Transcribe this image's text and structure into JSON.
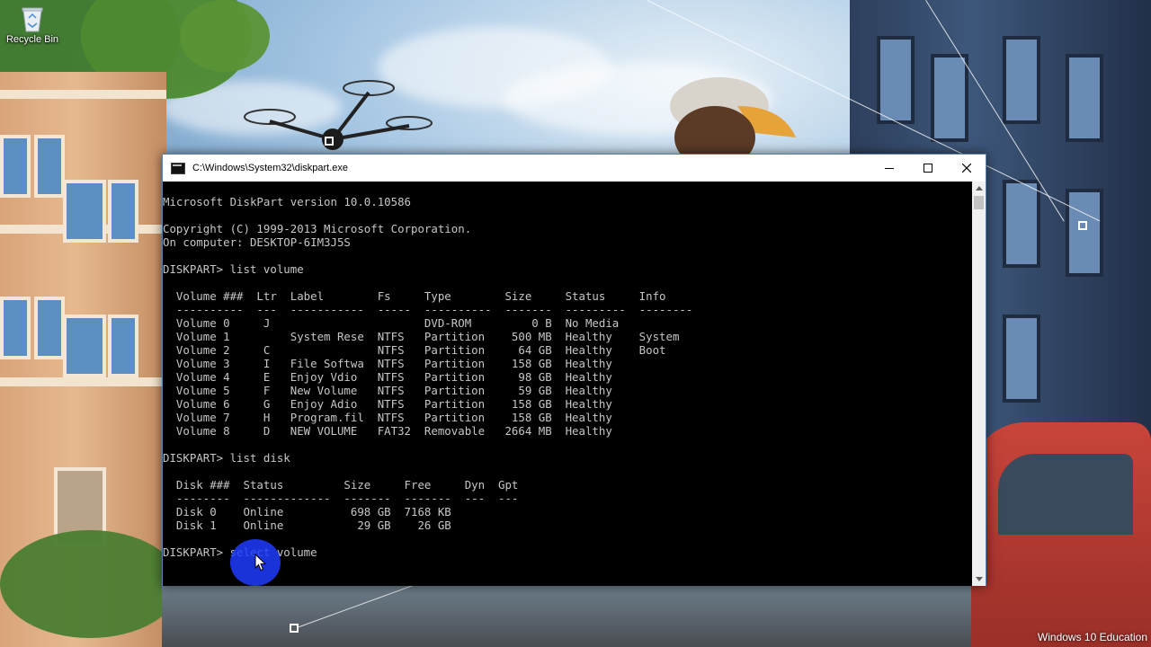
{
  "desktop": {
    "icons": [
      {
        "label": "Recycle Bin",
        "icon": "recycle-bin-icon"
      }
    ],
    "watermark": "Windows 10 Education"
  },
  "window": {
    "title": "C:\\Windows\\System32\\diskpart.exe",
    "controls": [
      "minimize",
      "maximize",
      "close"
    ]
  },
  "console": {
    "lines": [
      "Microsoft DiskPart version 10.0.10586",
      "",
      "Copyright (C) 1999-2013 Microsoft Corporation.",
      "On computer: DESKTOP-6IM3J5S",
      "",
      "DISKPART> list volume",
      "",
      "  Volume ###  Ltr  Label        Fs     Type        Size     Status     Info",
      "  ----------  ---  -----------  -----  ----------  -------  ---------  --------",
      "  Volume 0     J                       DVD-ROM         0 B  No Media",
      "  Volume 1         System Rese  NTFS   Partition    500 MB  Healthy    System",
      "  Volume 2     C                NTFS   Partition     64 GB  Healthy    Boot",
      "  Volume 3     I   File Softwa  NTFS   Partition    158 GB  Healthy",
      "  Volume 4     E   Enjoy Vdio   NTFS   Partition     98 GB  Healthy",
      "  Volume 5     F   New Volume   NTFS   Partition     59 GB  Healthy",
      "  Volume 6     G   Enjoy Adio   NTFS   Partition    158 GB  Healthy",
      "  Volume 7     H   Program.fil  NTFS   Partition    158 GB  Healthy",
      "  Volume 8     D   NEW VOLUME   FAT32  Removable   2664 MB  Healthy",
      "",
      "DISKPART> list disk",
      "",
      "  Disk ###  Status         Size     Free     Dyn  Gpt",
      "  --------  -------------  -------  -------  ---  ---",
      "  Disk 0    Online          698 GB  7168 KB",
      "  Disk 1    Online           29 GB    26 GB",
      "",
      "DISKPART> select volume"
    ]
  },
  "colors": {
    "console_bg": "#000000",
    "console_text": "#c6c6c6",
    "titlebar_bg": "#ffffff",
    "click_highlight": "#1e3cff"
  }
}
